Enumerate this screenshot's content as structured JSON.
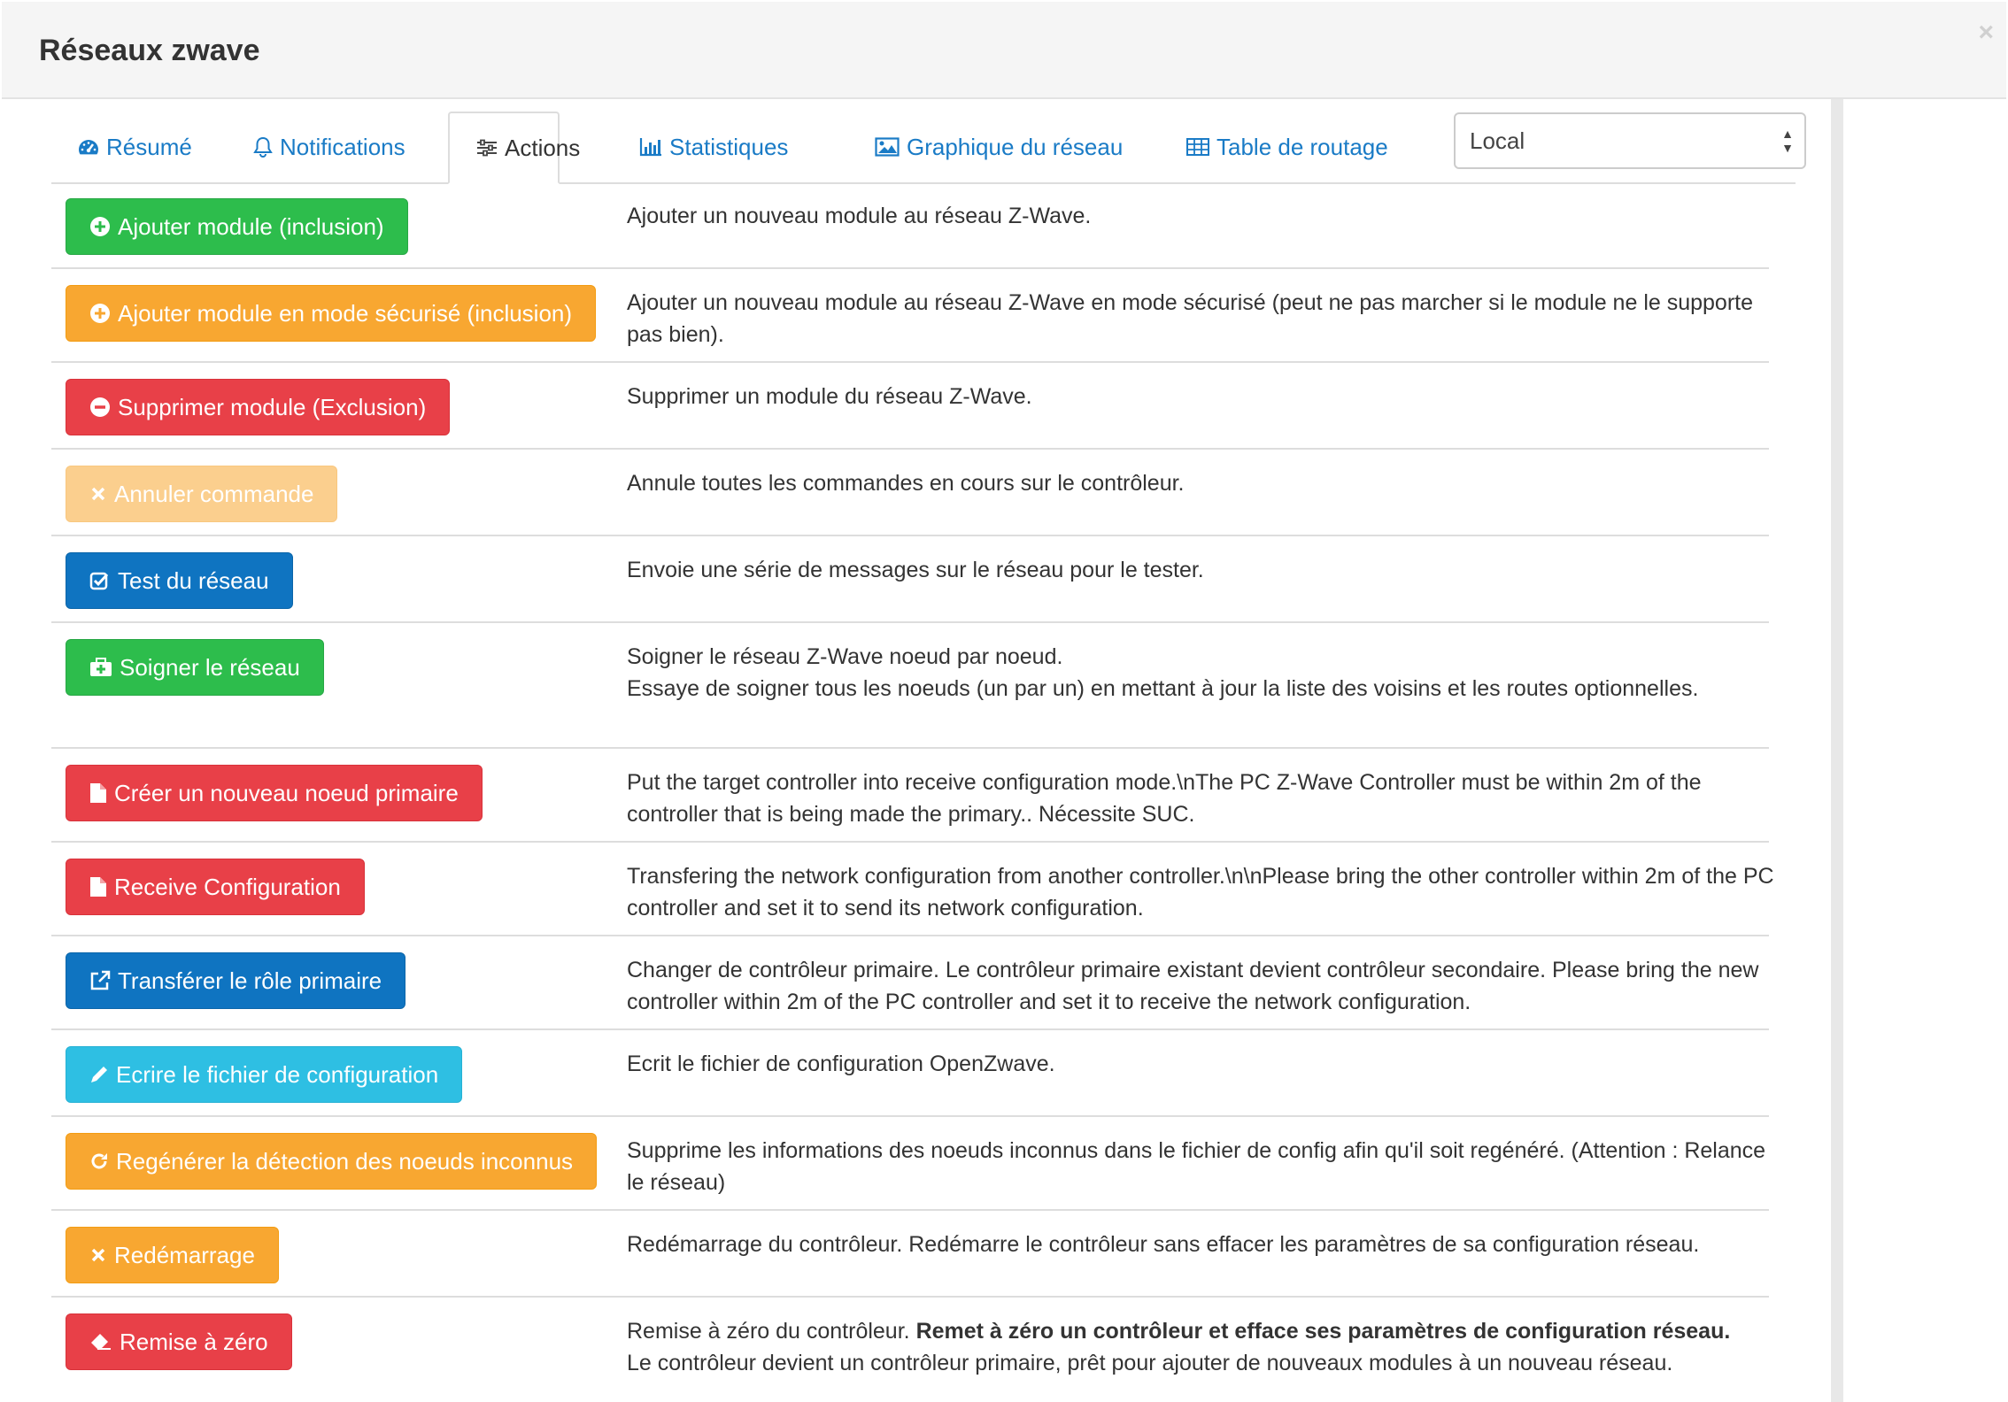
{
  "modal": {
    "title": "Réseaux zwave",
    "close_label": "×"
  },
  "tabs": [
    {
      "label": "Résumé",
      "icon": "dashboard-icon"
    },
    {
      "label": "Notifications",
      "icon": "bell-icon"
    },
    {
      "label": "Actions",
      "icon": "sliders-icon",
      "active": true
    },
    {
      "label": "Statistiques",
      "icon": "bar-chart-icon"
    },
    {
      "label": "Graphique du réseau",
      "icon": "picture-icon"
    },
    {
      "label": "Table de routage",
      "icon": "table-icon"
    }
  ],
  "controller_select": {
    "value": "Local"
  },
  "actions": [
    {
      "button": "Ajouter module (inclusion)",
      "icon": "plus-circle-icon",
      "color": "#2dbd4c",
      "desc": "Ajouter un nouveau module au réseau Z-Wave."
    },
    {
      "button": "Ajouter module en mode sécurisé (inclusion)",
      "icon": "plus-circle-icon",
      "color": "#f8a731",
      "desc": "Ajouter un nouveau module au réseau Z-Wave en mode sécurisé (peut ne pas marcher si le module ne le supporte pas bien)."
    },
    {
      "button": "Supprimer module (Exclusion)",
      "icon": "minus-circle-icon",
      "color": "#e84048",
      "desc": "Supprimer un module du réseau Z-Wave."
    },
    {
      "button": "Annuler commande",
      "icon": "times-icon",
      "color": "#fbcf8e",
      "desc": "Annule toutes les commandes en cours sur le contrôleur."
    },
    {
      "button": "Test du réseau",
      "icon": "check-square-icon",
      "color": "#0f74c1",
      "desc": "Envoie une série de messages sur le réseau pour le tester."
    },
    {
      "button": "Soigner le réseau",
      "icon": "medkit-icon",
      "color": "#2dbd4c",
      "desc_line1": "Soigner le réseau Z-Wave noeud par noeud.",
      "desc_line2": "Essaye de soigner tous les noeuds (un par un) en mettant à jour la liste des voisins et les routes optionnelles."
    },
    {
      "button": "Créer un nouveau noeud primaire",
      "icon": "file-icon",
      "color": "#e84048",
      "desc": "Put the target controller into receive configuration mode.\\nThe PC Z-Wave Controller must be within 2m of the controller that is being made the primary.. Nécessite SUC."
    },
    {
      "button": "Receive Configuration",
      "icon": "file-icon",
      "color": "#e84048",
      "desc": "Transfering the network configuration from another controller.\\n\\nPlease bring the other controller within 2m of the PC controller and set it to send its network configuration."
    },
    {
      "button": "Transférer le rôle primaire",
      "icon": "external-link-icon",
      "color": "#0f74c1",
      "desc": "Changer de contrôleur primaire. Le contrôleur primaire existant devient contrôleur secondaire. Please bring the new controller within 2m of the PC controller and set it to receive the network configuration."
    },
    {
      "button": "Ecrire le fichier de configuration",
      "icon": "pencil-icon",
      "color": "#2ebfe3",
      "desc": "Ecrit le fichier de configuration OpenZwave."
    },
    {
      "button": "Regénérer la détection des noeuds inconnus",
      "icon": "refresh-icon",
      "color": "#f8a731",
      "desc": "Supprime les informations des noeuds inconnus dans le fichier de config afin qu'il soit regénéré. (Attention : Relance le réseau)"
    },
    {
      "button": "Redémarrage",
      "icon": "times-icon",
      "color": "#f8a731",
      "desc": "Redémarrage du contrôleur. Redémarre le contrôleur sans effacer les paramètres de sa configuration réseau."
    },
    {
      "button": "Remise à zéro",
      "icon": "eraser-icon",
      "color": "#e84048",
      "desc_pre": "Remise à zéro du contrôleur. ",
      "desc_bold": "Remet à zéro un contrôleur et efface ses paramètres de configuration réseau.",
      "desc_post": "Le contrôleur devient un contrôleur primaire, prêt pour ajouter de nouveaux modules à un nouveau réseau."
    }
  ]
}
